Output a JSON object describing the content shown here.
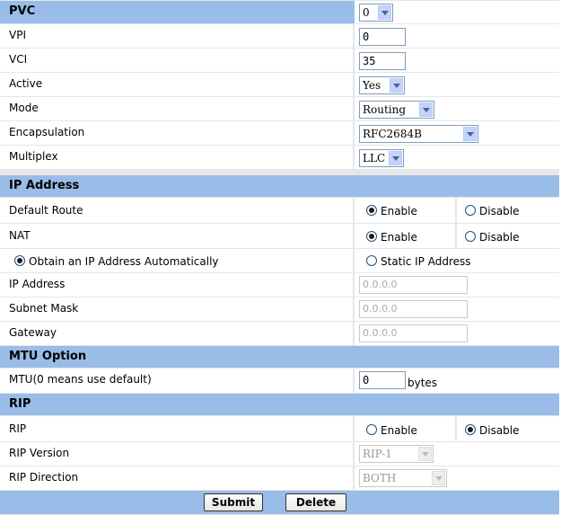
{
  "pvc_section": {
    "title": "PVC",
    "pvc_select_value": "0",
    "vpi_label": "VPI",
    "vpi_value": "0",
    "vci_label": "VCI",
    "vci_value": "35",
    "active_label": "Active",
    "active_value": "Yes",
    "mode_label": "Mode",
    "mode_value": "Routing",
    "encap_label": "Encapsulation",
    "encap_value": "RFC2684B",
    "multiplex_label": "Multiplex",
    "multiplex_value": "LLC"
  },
  "ip_section": {
    "title": "IP Address",
    "default_route_label": "Default Route",
    "nat_label": "NAT",
    "enable_label": "Enable",
    "disable_label": "Disable",
    "obtain_auto_label": "Obtain an IP Address Automatically",
    "static_ip_label": "Static IP Address",
    "ip_label": "IP Address",
    "ip_value": "0.0.0.0",
    "mask_label": "Subnet Mask",
    "mask_value": "0.0.0.0",
    "gateway_label": "Gateway",
    "gateway_value": "0.0.0.0"
  },
  "mtu_section": {
    "title": "MTU Option",
    "mtu_label": "MTU(0 means use default)",
    "mtu_value": "0",
    "mtu_unit": "bytes"
  },
  "rip_section": {
    "title": "RIP",
    "rip_label": "RIP",
    "enable_label": "Enable",
    "disable_label": "Disable",
    "version_label": "RIP Version",
    "version_value": "RIP-1",
    "direction_label": "RIP Direction",
    "direction_value": "BOTH"
  },
  "actions": {
    "submit_label": "Submit",
    "delete_label": "Delete"
  }
}
